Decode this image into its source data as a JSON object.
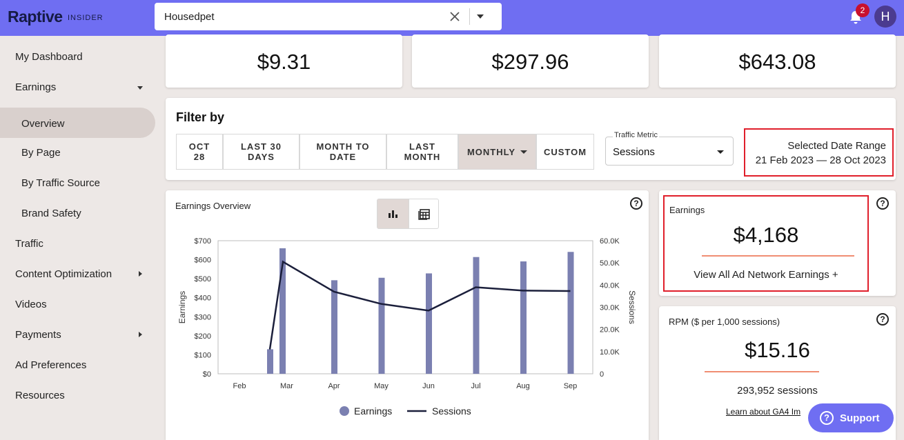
{
  "header": {
    "logo": "Raptive",
    "logo_sub": "INSIDER",
    "site_value": "Housedpet",
    "notification_count": "2",
    "avatar_initial": "H"
  },
  "sidebar": {
    "items": [
      {
        "label": "My Dashboard"
      },
      {
        "label": "Earnings"
      },
      {
        "label": "Overview"
      },
      {
        "label": "By Page"
      },
      {
        "label": "By Traffic Source"
      },
      {
        "label": "Brand Safety"
      },
      {
        "label": "Traffic"
      },
      {
        "label": "Content Optimization"
      },
      {
        "label": "Videos"
      },
      {
        "label": "Payments"
      },
      {
        "label": "Ad Preferences"
      },
      {
        "label": "Resources"
      }
    ]
  },
  "stats": {
    "v1": "$9.31",
    "v2": "$297.96",
    "v3": "$643.08"
  },
  "filter": {
    "title": "Filter by",
    "buttons": [
      {
        "label": "OCT\n28"
      },
      {
        "label": "LAST 30\nDAYS"
      },
      {
        "label": "MONTH TO\nDATE"
      },
      {
        "label": "LAST\nMONTH"
      },
      {
        "label": "MONTHLY"
      },
      {
        "label": "CUSTOM"
      }
    ],
    "metric_label": "Traffic Metric",
    "metric_value": "Sessions",
    "range_label": "Selected Date Range",
    "range_value": "21 Feb 2023 — 28 Oct 2023"
  },
  "chart_card": {
    "title": "Earnings Overview",
    "help": "?"
  },
  "chart_data": {
    "type": "bar",
    "categories": [
      "Feb",
      "Mar",
      "Apr",
      "May",
      "Jun",
      "Jul",
      "Aug",
      "Sep"
    ],
    "series": [
      {
        "name": "Earnings",
        "type": "bar",
        "axis": "left",
        "color": "#7b80b1",
        "values": [
          129,
          660,
          492,
          505,
          528,
          614,
          591,
          641
        ]
      },
      {
        "name": "Sessions",
        "type": "line",
        "axis": "right",
        "color": "#1b1f3b",
        "values": [
          11000,
          50500,
          37000,
          31500,
          28500,
          39000,
          37500,
          37300
        ]
      }
    ],
    "ylabel": "Earnings",
    "y2label": "Sessions",
    "ylim": [
      0,
      700
    ],
    "y2lim": [
      0,
      60000
    ],
    "yticks": [
      "$0",
      "$100",
      "$200",
      "$300",
      "$400",
      "$500",
      "$600",
      "$700"
    ],
    "y2ticks": [
      "0",
      "10.0K",
      "20.0K",
      "30.0K",
      "40.0K",
      "50.0K",
      "60.0K"
    ],
    "legend": "bottom",
    "grid": false
  },
  "earnings_card": {
    "title": "Earnings",
    "value": "$4,168",
    "link": "View All Ad Network Earnings +"
  },
  "rpm_card": {
    "title": "RPM ($ per 1,000 sessions)",
    "value": "$15.16",
    "sessions": "293,952 sessions",
    "link": "Learn about GA4 Im"
  },
  "support": {
    "label": "Support"
  }
}
